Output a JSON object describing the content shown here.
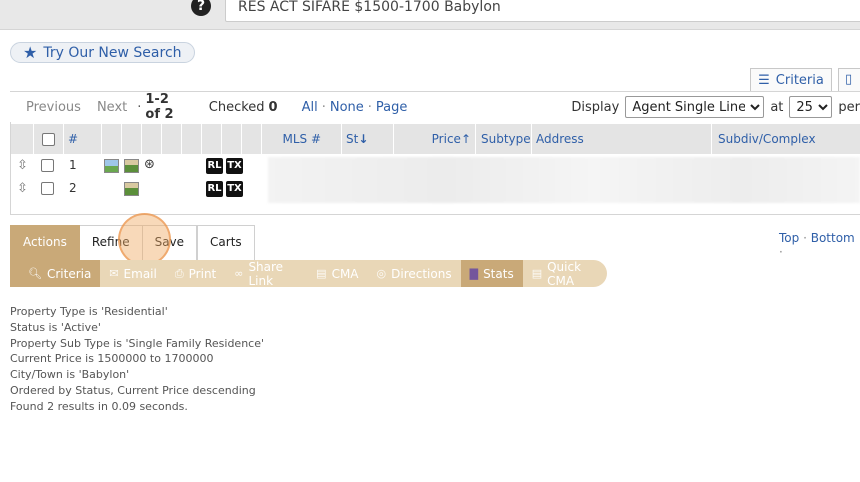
{
  "topbar": {
    "help_icon": "?",
    "search_value": "RES ACT SIFARE $1500-1700 Babylon"
  },
  "try_search": {
    "label": "Try Our New Search"
  },
  "tools": {
    "criteria_label": "Criteria"
  },
  "pager": {
    "previous": "Previous",
    "next": "Next",
    "range": "1-2 of 2",
    "checked_label": "Checked",
    "checked_count": "0",
    "all": "All",
    "none": "None",
    "page": "Page",
    "display_label": "Display",
    "display_value": "Agent Single Line",
    "at_label": "at",
    "per_page_value": "25",
    "per_label": "per"
  },
  "grid": {
    "headers": {
      "num": "#",
      "mls": "MLS #",
      "status": "St",
      "price": "Price",
      "subtype": "Subtype",
      "address": "Address",
      "subdiv": "Subdiv/Complex"
    },
    "rows": [
      {
        "num": "1",
        "badge1": "RL",
        "badge2": "TX"
      },
      {
        "num": "2",
        "badge1": "RL",
        "badge2": "TX"
      }
    ]
  },
  "tabs": [
    {
      "label": "Actions"
    },
    {
      "label": "Refine"
    },
    {
      "label": "Save"
    },
    {
      "label": "Carts"
    }
  ],
  "links": {
    "top": "Top",
    "bottom": "Bottom"
  },
  "actions": [
    {
      "label": "Criteria",
      "icon": "search-icon"
    },
    {
      "label": "Email",
      "icon": "email-icon"
    },
    {
      "label": "Print",
      "icon": "print-icon"
    },
    {
      "label": "Share Link",
      "icon": "link-icon"
    },
    {
      "label": "CMA",
      "icon": "document-icon"
    },
    {
      "label": "Directions",
      "icon": "compass-icon"
    },
    {
      "label": "Stats",
      "icon": "bar-chart-icon"
    },
    {
      "label": "Quick CMA",
      "icon": "document-icon"
    }
  ],
  "criteria_lines": [
    "Property Type is 'Residential'",
    "Status is 'Active'",
    "Property Sub Type is 'Single Family Residence'",
    "Current Price is 1500000 to 1700000",
    "City/Town is 'Babylon'",
    "Ordered by Status, Current Price descending",
    "Found 2 results in 0.09 seconds."
  ],
  "colors": {
    "accent": "#2f5fa8",
    "tab_active": "#c9a978",
    "action_bar": "#e9d7b7",
    "highlight": "#f0aa64"
  }
}
